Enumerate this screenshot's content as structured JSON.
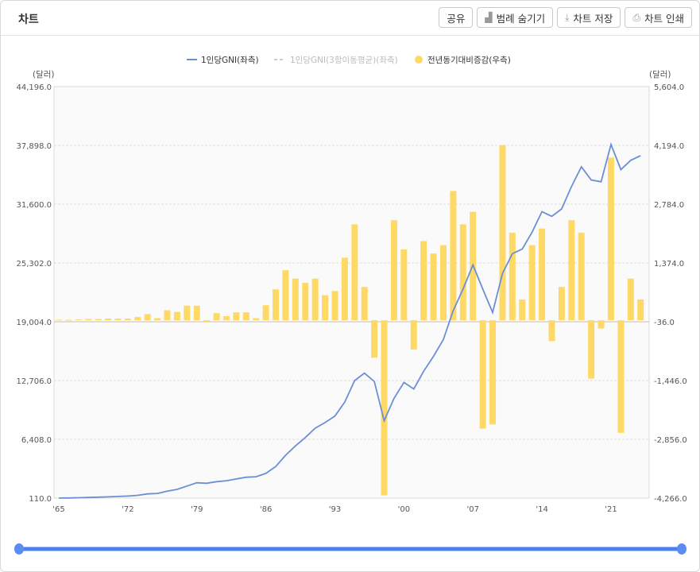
{
  "header": {
    "title": "차트",
    "buttons": [
      {
        "label": "공유",
        "icon": ""
      },
      {
        "label": "범례 숨기기",
        "icon": "bar-chart-icon"
      },
      {
        "label": "차트 저장",
        "icon": "download-icon"
      },
      {
        "label": "차트 인쇄",
        "icon": "print-icon"
      }
    ]
  },
  "colors": {
    "line": "#6b8fd6",
    "bar": "#ffd966",
    "avg": "#cccccc",
    "slider": "#4a7ff0"
  },
  "chart_data": {
    "type": "bar+line",
    "legend": [
      "1인당GNI(좌측)",
      "1인당GNI(3항이동평균)(좌측)",
      "전년동기대비증감(우측)"
    ],
    "legend_placement": "top-center",
    "left_unit": "(달러)",
    "right_unit": "(달러)",
    "left_ticks": [
      "110.0",
      "6,408.0",
      "12,706.0",
      "19,004.0",
      "25,302.0",
      "31,600.0",
      "37,898.0",
      "44,196.0"
    ],
    "right_ticks": [
      "-4,266.0",
      "-2,856.0",
      "-1,446.0",
      "-36.0",
      "1,374.0",
      "2,784.0",
      "4,194.0",
      "5,604.0"
    ],
    "left_ylim": [
      110,
      44196
    ],
    "right_ylim": [
      -4266,
      5604
    ],
    "x_ticks": [
      "'65",
      "'72",
      "'79",
      "'86",
      "'93",
      "'00",
      "'07",
      "'14",
      "'21"
    ],
    "x_start": 1965,
    "gni": [
      120,
      130,
      150,
      180,
      210,
      250,
      290,
      330,
      410,
      560,
      610,
      850,
      1050,
      1400,
      1750,
      1700,
      1870,
      1970,
      2160,
      2350,
      2400,
      2760,
      3500,
      4700,
      5700,
      6600,
      7600,
      8200,
      8900,
      10400,
      12700,
      13500,
      12600,
      8400,
      10800,
      12500,
      11800,
      13700,
      15300,
      17100,
      20200,
      22500,
      25100,
      22500,
      20000,
      24200,
      26300,
      26800,
      28600,
      30800,
      30300,
      31100,
      33500,
      35600,
      34200,
      34000,
      38000,
      35300,
      36300,
      36800
    ],
    "yoy": [
      15,
      10,
      20,
      30,
      30,
      40,
      40,
      40,
      80,
      150,
      50,
      240,
      200,
      350,
      350,
      -50,
      170,
      100,
      190,
      190,
      50,
      360,
      740,
      1200,
      1000,
      900,
      1000,
      600,
      700,
      1500,
      2300,
      800,
      -900,
      -4200,
      2400,
      1700,
      -700,
      1900,
      1600,
      1800,
      3100,
      2300,
      2600,
      -2600,
      -2500,
      4200,
      2100,
      500,
      1800,
      2200,
      -500,
      800,
      2400,
      2100,
      -1400,
      -200,
      3900,
      -2700,
      1000,
      500
    ]
  }
}
